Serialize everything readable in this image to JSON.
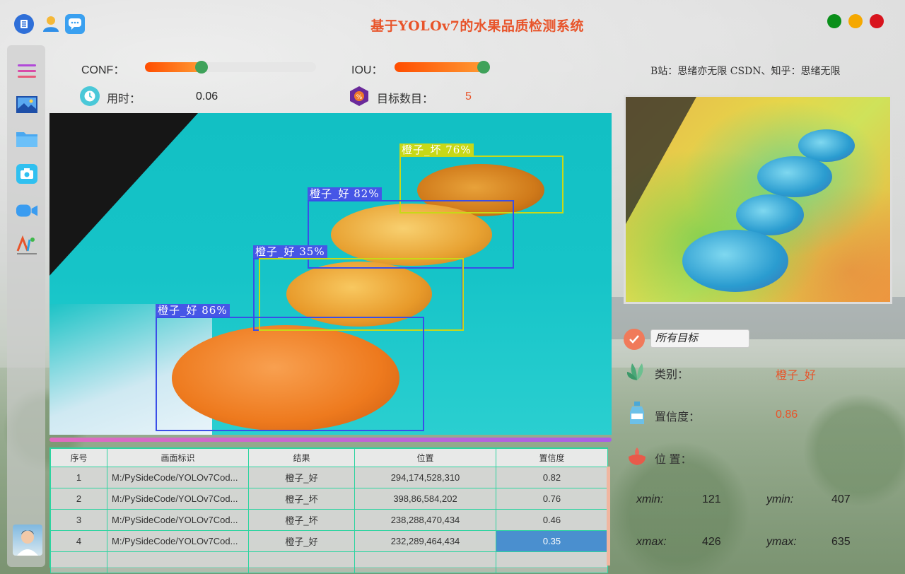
{
  "app": {
    "title": "基于YOLOv7的水果品质检测系统",
    "credit": "B站：思绪亦无限 CSDN、知乎：思绪无限"
  },
  "window_controls": {
    "colors": [
      "#0a8f1a",
      "#f5a800",
      "#d8141e"
    ]
  },
  "topbar_icons": [
    "app-logo-icon",
    "user-icon",
    "chat-icon"
  ],
  "sidebar": {
    "items": [
      {
        "icon": "menu-icon"
      },
      {
        "icon": "image-icon"
      },
      {
        "icon": "folder-icon"
      },
      {
        "icon": "camera-icon"
      },
      {
        "icon": "video-icon"
      },
      {
        "icon": "ai-logo-icon"
      }
    ]
  },
  "controls": {
    "conf_label": "CONF：",
    "conf_value": 0.33,
    "iou_label": "IOU：",
    "iou_value": 0.5,
    "time_label": "用时：",
    "time_value": "0.06",
    "count_label": "目标数目：",
    "count_value": "5"
  },
  "detections": [
    {
      "label": "橙子_坏 76%",
      "color": "#c8d818"
    },
    {
      "label": "橙子_好 82%",
      "color": "#3a4ee8"
    },
    {
      "label": "橙子_好 35%",
      "color": "#3a4ee8"
    },
    {
      "label": "橙子_好 86%",
      "color": "#3a4ee8"
    }
  ],
  "table": {
    "headers": [
      "序号",
      "画面标识",
      "结果",
      "位置",
      "置信度"
    ],
    "rows": [
      {
        "idx": "1",
        "src": "M:/PySideCode/YOLOv7Cod...",
        "result": "橙子_好",
        "pos": "294,174,528,310",
        "conf": "0.82"
      },
      {
        "idx": "2",
        "src": "M:/PySideCode/YOLOv7Cod...",
        "result": "橙子_坏",
        "pos": "398,86,584,202",
        "conf": "0.76"
      },
      {
        "idx": "3",
        "src": "M:/PySideCode/YOLOv7Cod...",
        "result": "橙子_坏",
        "pos": "238,288,470,434",
        "conf": "0.46"
      },
      {
        "idx": "4",
        "src": "M:/PySideCode/YOLOv7Cod...",
        "result": "橙子_好",
        "pos": "232,289,464,434",
        "conf": "0.35"
      }
    ],
    "selected_row": 3
  },
  "details": {
    "target_select": "所有目标",
    "class_label": "类别：",
    "class_value": "橙子_好",
    "conf_label": "置信度：",
    "conf_value": "0.86",
    "pos_label": "位 置：",
    "xmin_label": "xmin:",
    "xmin": "121",
    "ymin_label": "ymin:",
    "ymin": "407",
    "xmax_label": "xmax:",
    "xmax": "426",
    "ymax_label": "ymax:",
    "ymax": "635"
  },
  "colors": {
    "accent": "#e8542a",
    "slider_handle": "#3fa25a",
    "table_border": "#2dd4a0",
    "selection": "#4a8fcf"
  }
}
